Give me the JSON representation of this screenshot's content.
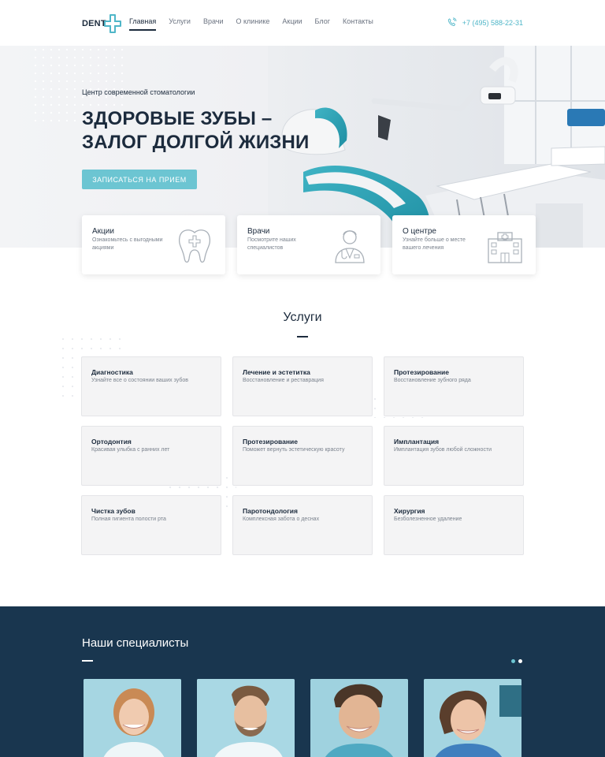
{
  "header": {
    "logo": "DENT",
    "nav": [
      "Главная",
      "Услуги",
      "Врачи",
      "О клинике",
      "Акции",
      "Блог",
      "Контакты"
    ],
    "active_nav": "Главная",
    "phone": "+7 (495) 588-22-31"
  },
  "hero": {
    "subtitle": "Центр современной стоматологии",
    "title_line1": "ЗДОРОВЫЕ ЗУБЫ –",
    "title_line2": "ЗАЛОГ ДОЛГОЙ ЖИЗНИ",
    "button": "ЗАПИСАТЬСЯ НА ПРИЕМ"
  },
  "features": [
    {
      "title": "Акции",
      "desc": "Ознакомьтесь с выгодными акциями",
      "icon": "tooth-icon"
    },
    {
      "title": "Врачи",
      "desc": "Посмотрите наших специалистов",
      "icon": "doctor-icon"
    },
    {
      "title": "О центре",
      "desc": "Узнайте больше о месте вашего лечения",
      "icon": "clinic-building-icon"
    }
  ],
  "services": {
    "title": "Услуги",
    "items": [
      {
        "title": "Диагностика",
        "desc": "Узнайте все о состоянии ваших зубов"
      },
      {
        "title": "Лечение и эстетитка",
        "desc": "Восстановление и реставрация"
      },
      {
        "title": "Протезирование",
        "desc": "Восстановление зубного ряда"
      },
      {
        "title": "Ортодонтия",
        "desc": "Красивая улыбка с ранних лет"
      },
      {
        "title": "Протезирование",
        "desc": "Поможет вернуть эстетическую красоту"
      },
      {
        "title": "Имплантация",
        "desc": "Имплантация зубов любой сложности"
      },
      {
        "title": "Чистка зубов",
        "desc": "Полная гигиента полости рта"
      },
      {
        "title": "Паротондология",
        "desc": "Комплексная забота о деснах"
      },
      {
        "title": "Хирургия",
        "desc": "Безболезненное удаление"
      }
    ]
  },
  "specialists": {
    "title": "Наши специалисты"
  },
  "colors": {
    "accent": "#6cc5d2",
    "dark": "#1c2b3d",
    "specialists_bg": "#19364f"
  }
}
